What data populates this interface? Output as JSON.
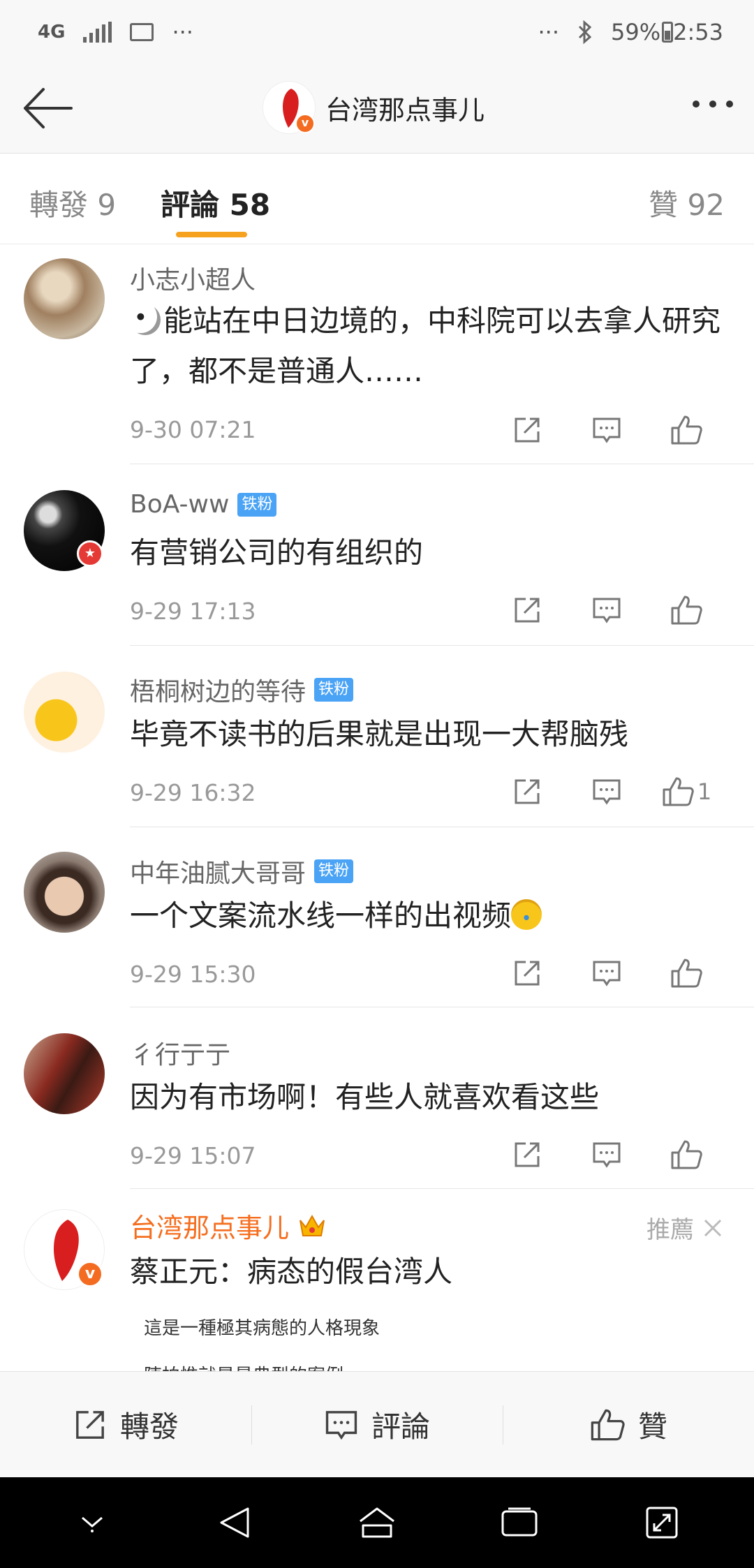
{
  "status_bar": {
    "network": "4G",
    "dots_left": "···",
    "dots_right": "···",
    "battery": "59%",
    "time": "2:53"
  },
  "nav": {
    "title": "台湾那点事儿"
  },
  "tabs": [
    {
      "label": "轉發",
      "count": "9"
    },
    {
      "label": "評論",
      "count": "58"
    },
    {
      "label": "贊",
      "count": "92"
    }
  ],
  "comments": [
    {
      "name": "小志小超人",
      "tag": "",
      "text": "能站在中日边境的，中科院可以去拿人研究了，都不是普通人……",
      "time": "9-30 07:21",
      "likes": ""
    },
    {
      "name": "BoA-ww",
      "tag": "铁粉",
      "text": "有营销公司的有组织的",
      "time": "9-29 17:13",
      "likes": ""
    },
    {
      "name": "梧桐树边的等待",
      "tag": "铁粉",
      "text": "毕竟不读书的后果就是出现一大帮脑残",
      "time": "9-29 16:32",
      "likes": "1"
    },
    {
      "name": "中年油腻大哥哥",
      "tag": "铁粉",
      "text": "一个文案流水线一样的出视频",
      "time": "9-29 15:30",
      "likes": ""
    },
    {
      "name": "彳行亍亍",
      "tag": "",
      "text": "因为有市场啊！有些人就喜欢看这些",
      "time": "9-29 15:07",
      "likes": ""
    }
  ],
  "recommended": {
    "name": "台湾那点事儿",
    "label": "推薦",
    "text": "蔡正元：病态的假台湾人",
    "preview_line1": "這是一種極其病態的人格現象",
    "preview_line2": "陳柏惟就是最典型的案例"
  },
  "bottom_bar": {
    "repost": "轉發",
    "comment": "評論",
    "like": "贊"
  },
  "colors": {
    "accent": "#f6a21e",
    "highlight_name": "#f56e1f",
    "fan_tag": "#4aa3f5"
  }
}
